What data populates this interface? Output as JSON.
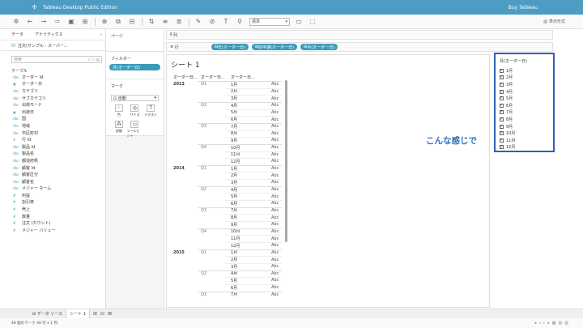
{
  "app": {
    "title": "Tableau Desktop Public Edition",
    "buy": "Buy Tableau"
  },
  "toolbar": {
    "format_select": "標準",
    "show_me": "表示形式"
  },
  "data_pane": {
    "tab_data": "データ",
    "tab_analytics": "アナリティクス",
    "collapse": "‹",
    "source": "注文(サンプル - スーパー...",
    "search_placeholder": "検索",
    "section_tables": "テーブル",
    "dimensions": [
      {
        "type": "Abc",
        "name": "オーダー Id"
      },
      {
        "type": "▣",
        "name": "オーダー日"
      },
      {
        "type": "Abc",
        "name": "カテゴリ"
      },
      {
        "type": "Abc",
        "name": "サブカテゴリ"
      },
      {
        "type": "Abc",
        "name": "出荷モード"
      },
      {
        "type": "▣",
        "name": "出荷日"
      },
      {
        "type": "Abc",
        "name": "国"
      },
      {
        "type": "Abc",
        "name": "地域"
      },
      {
        "type": "Abc",
        "name": "市区町村"
      },
      {
        "type": "#",
        "name": "行 Id"
      },
      {
        "type": "Abc",
        "name": "製品 Id"
      },
      {
        "type": "Abc",
        "name": "製品名"
      },
      {
        "type": "Abc",
        "name": "都道府県"
      },
      {
        "type": "Abc",
        "name": "顧客 Id"
      },
      {
        "type": "Abc",
        "name": "顧客区分"
      },
      {
        "type": "Abc",
        "name": "顧客名"
      },
      {
        "type": "Abc",
        "name": "メジャー ネーム"
      }
    ],
    "measures": [
      {
        "type": "#",
        "name": "利益"
      },
      {
        "type": "#",
        "name": "割引率"
      },
      {
        "type": "#",
        "name": "売上"
      },
      {
        "type": "#",
        "name": "数量"
      },
      {
        "type": "#",
        "name": "注文 (カウント)"
      },
      {
        "type": "#",
        "name": "メジャー バリュー"
      }
    ]
  },
  "shelves": {
    "pages_label": "ページ",
    "columns_label": "列",
    "rows_label": "行",
    "filters_label": "フィルター",
    "filter_pill": "月(オーダー日)",
    "marks_label": "マーク",
    "marks_type": "自動",
    "marks_buttons": [
      "色",
      "サイズ",
      "テキスト",
      "詳細",
      "ツールヒント"
    ],
    "row_pills": [
      "年(オーダー日)",
      "四半期(オーダー日)",
      "月(オーダー日)"
    ]
  },
  "view": {
    "sheet_title": "シート 1",
    "headers": [
      "オーダー日...",
      "オーダー日...",
      "オーダー日..."
    ],
    "rows": [
      {
        "year": "2013",
        "quarter": "Q1",
        "month": "1月",
        "val": "Abc"
      },
      {
        "year": "",
        "quarter": "",
        "month": "2月",
        "val": "Abc"
      },
      {
        "year": "",
        "quarter": "",
        "month": "3月",
        "val": "Abc"
      },
      {
        "year": "",
        "quarter": "Q2",
        "month": "4月",
        "val": "Abc"
      },
      {
        "year": "",
        "quarter": "",
        "month": "5月",
        "val": "Abc"
      },
      {
        "year": "",
        "quarter": "",
        "month": "6月",
        "val": "Abc"
      },
      {
        "year": "",
        "quarter": "Q3",
        "month": "7月",
        "val": "Abc"
      },
      {
        "year": "",
        "quarter": "",
        "month": "8月",
        "val": "Abc"
      },
      {
        "year": "",
        "quarter": "",
        "month": "9月",
        "val": "Abc"
      },
      {
        "year": "",
        "quarter": "Q4",
        "month": "10月",
        "val": "Abc"
      },
      {
        "year": "",
        "quarter": "",
        "month": "11月",
        "val": "Abc"
      },
      {
        "year": "",
        "quarter": "",
        "month": "12月",
        "val": "Abc"
      },
      {
        "year": "2014",
        "quarter": "Q1",
        "month": "1月",
        "val": "Abc"
      },
      {
        "year": "",
        "quarter": "",
        "month": "2月",
        "val": "Abc"
      },
      {
        "year": "",
        "quarter": "",
        "month": "3月",
        "val": "Abc"
      },
      {
        "year": "",
        "quarter": "Q2",
        "month": "4月",
        "val": "Abc"
      },
      {
        "year": "",
        "quarter": "",
        "month": "5月",
        "val": "Abc"
      },
      {
        "year": "",
        "quarter": "",
        "month": "6月",
        "val": "Abc"
      },
      {
        "year": "",
        "quarter": "Q3",
        "month": "7月",
        "val": "Abc"
      },
      {
        "year": "",
        "quarter": "",
        "month": "8月",
        "val": "Abc"
      },
      {
        "year": "",
        "quarter": "",
        "month": "9月",
        "val": "Abc"
      },
      {
        "year": "",
        "quarter": "Q4",
        "month": "10月",
        "val": "Abc"
      },
      {
        "year": "",
        "quarter": "",
        "month": "11月",
        "val": "Abc"
      },
      {
        "year": "",
        "quarter": "",
        "month": "12月",
        "val": "Abc"
      },
      {
        "year": "2015",
        "quarter": "Q1",
        "month": "1月",
        "val": "Abc"
      },
      {
        "year": "",
        "quarter": "",
        "month": "2月",
        "val": "Abc"
      },
      {
        "year": "",
        "quarter": "",
        "month": "3月",
        "val": "Abc"
      },
      {
        "year": "",
        "quarter": "Q2",
        "month": "4月",
        "val": "Abc"
      },
      {
        "year": "",
        "quarter": "",
        "month": "5月",
        "val": "Abc"
      },
      {
        "year": "",
        "quarter": "",
        "month": "6月",
        "val": "Abc"
      },
      {
        "year": "",
        "quarter": "Q3",
        "month": "7月",
        "val": "Abc"
      }
    ]
  },
  "annotation": "こんな感じで",
  "filter_card": {
    "title": "月(オーダー日)",
    "items": [
      "1月",
      "2月",
      "3月",
      "4月",
      "5月",
      "6月",
      "7月",
      "8月",
      "9月",
      "10月",
      "11月",
      "12月"
    ]
  },
  "bottom": {
    "data_source_tab": "データ ソース",
    "sheet_tab": "シート 1",
    "status": "48 個のマーク   48 行 x 1 列"
  },
  "colors": {
    "titlebar": "#4d9cc4",
    "pill": "#3a9bb9",
    "annotation": "#2e73c0",
    "highlight_border": "#2d5fb8"
  }
}
